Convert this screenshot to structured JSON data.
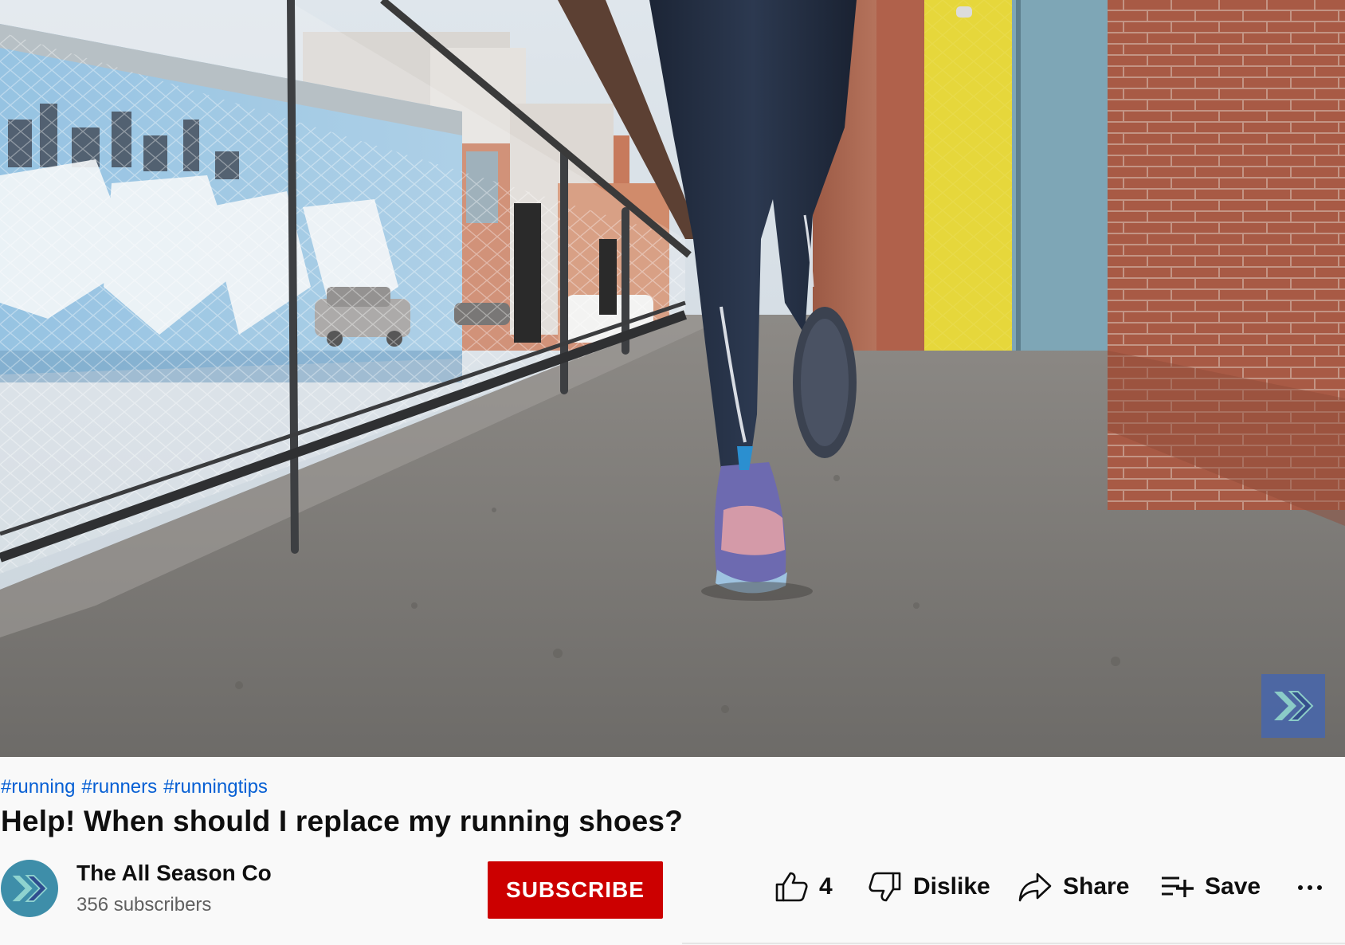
{
  "video": {
    "hashtags": [
      "#running",
      "#runners",
      "#runningtips"
    ],
    "title": "Help! When should I replace my running shoes?"
  },
  "channel": {
    "name": "The All Season Co",
    "subscribers": "356 subscribers",
    "subscribe_label": "SUBSCRIBE"
  },
  "actions": {
    "like_count": "4",
    "dislike_label": "Dislike",
    "share_label": "Share",
    "save_label": "Save"
  },
  "colors": {
    "link": "#065fd4",
    "subscribe": "#cc0000",
    "brand": "#3e8ea9"
  }
}
